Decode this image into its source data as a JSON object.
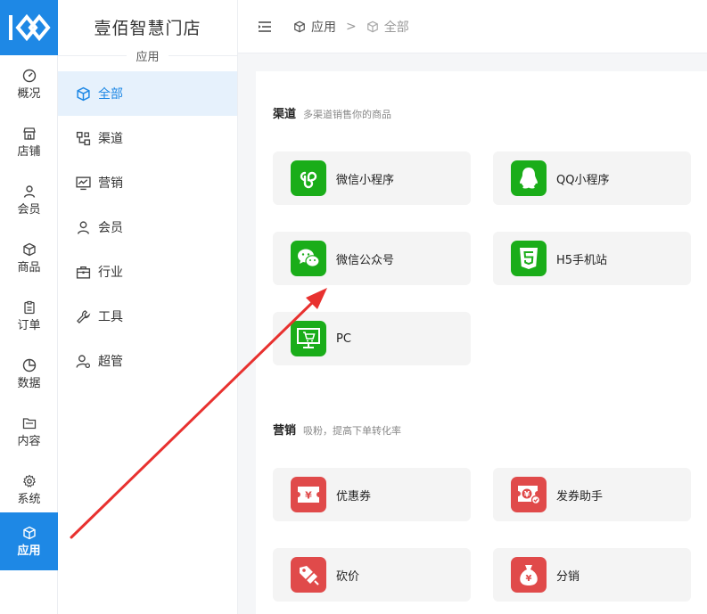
{
  "rail": {
    "items": [
      {
        "label": "概况",
        "icon": "dashboard-icon"
      },
      {
        "label": "店铺",
        "icon": "store-icon"
      },
      {
        "label": "会员",
        "icon": "user-icon"
      },
      {
        "label": "商品",
        "icon": "box-icon"
      },
      {
        "label": "订单",
        "icon": "clipboard-icon"
      },
      {
        "label": "数据",
        "icon": "pie-icon"
      },
      {
        "label": "内容",
        "icon": "folder-icon"
      },
      {
        "label": "系统",
        "icon": "gear-icon"
      },
      {
        "label": "应用",
        "icon": "cube-icon"
      }
    ],
    "active": "应用"
  },
  "panel": {
    "store_name": "壹佰智慧门店",
    "subtitle": "应用",
    "items": [
      {
        "label": "全部",
        "icon": "cube-icon"
      },
      {
        "label": "渠道",
        "icon": "channel-icon"
      },
      {
        "label": "营销",
        "icon": "trend-icon"
      },
      {
        "label": "会员",
        "icon": "user-icon"
      },
      {
        "label": "行业",
        "icon": "briefcase-icon"
      },
      {
        "label": "工具",
        "icon": "wrench-icon"
      },
      {
        "label": "超管",
        "icon": "admin-icon"
      }
    ],
    "active": "全部"
  },
  "breadcrumb": {
    "root": "应用",
    "separator": ">",
    "current": "全部"
  },
  "sections": {
    "channel": {
      "title": "渠道",
      "desc": "多渠道销售你的商品",
      "tiles": [
        {
          "label": "微信小程序",
          "icon": "mini-program-icon"
        },
        {
          "label": "QQ小程序",
          "icon": "qq-icon"
        },
        {
          "label": "微信公众号",
          "icon": "wechat-icon"
        },
        {
          "label": "H5手机站",
          "icon": "html5-icon"
        },
        {
          "label": "PC",
          "icon": "monitor-cart-icon"
        }
      ]
    },
    "marketing": {
      "title": "营销",
      "desc": "吸粉，提高下单转化率",
      "tiles": [
        {
          "label": "优惠券",
          "icon": "coupon-icon"
        },
        {
          "label": "发券助手",
          "icon": "coupon-send-icon"
        },
        {
          "label": "砍价",
          "icon": "bargain-icon"
        },
        {
          "label": "分销",
          "icon": "money-bag-icon"
        }
      ]
    }
  },
  "colors": {
    "accent": "#1e88e5",
    "channel_icon_bg": "#1aad19",
    "marketing_icon_bg": "#e04a4a",
    "arrow": "#e8312f"
  }
}
